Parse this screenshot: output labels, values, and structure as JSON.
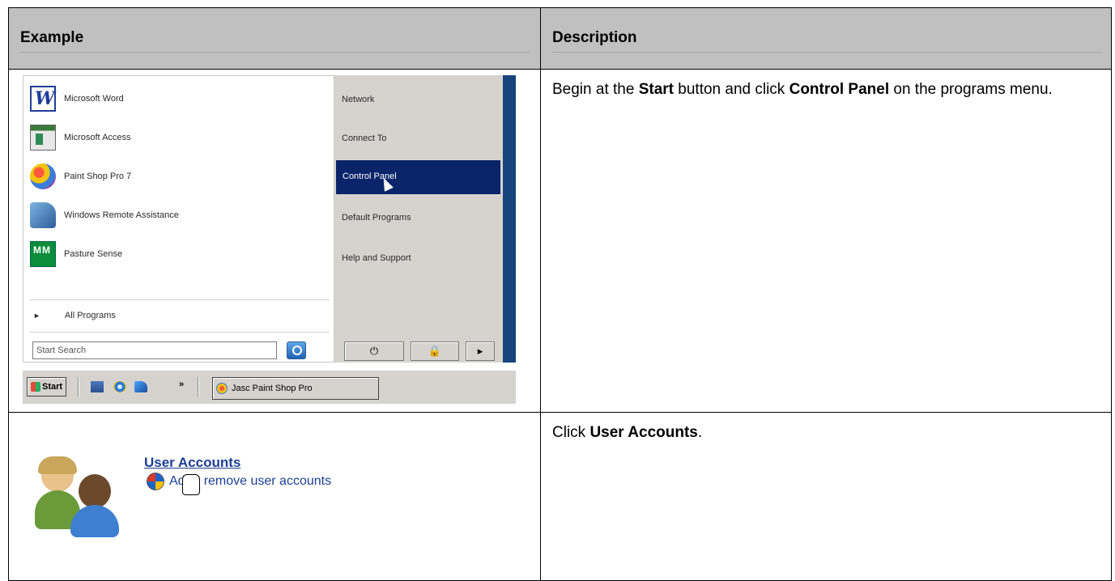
{
  "table": {
    "header_example": "Example",
    "header_description": "Description"
  },
  "rows": [
    {
      "description": [
        {
          "text": "Begin at the ",
          "bold": false
        },
        {
          "text": "Start",
          "bold": true
        },
        {
          "text": " button and click ",
          "bold": false
        },
        {
          "text": "Control Panel",
          "bold": true
        },
        {
          "text": " on the programs menu.",
          "bold": false
        }
      ]
    },
    {
      "description": [
        {
          "text": "Click ",
          "bold": false
        },
        {
          "text": "User Accounts",
          "bold": true
        },
        {
          "text": ".",
          "bold": false
        }
      ]
    }
  ],
  "start_menu": {
    "programs": [
      {
        "label": "Microsoft Word",
        "icon": "word-icon"
      },
      {
        "label": "Microsoft Access",
        "icon": "access-icon"
      },
      {
        "label": "Paint Shop Pro 7",
        "icon": "paint-shop-pro-icon"
      },
      {
        "label": "Windows Remote Assistance",
        "icon": "remote-assistance-icon"
      },
      {
        "label": "Pasture Sense",
        "icon": "pasture-sense-icon"
      }
    ],
    "all_programs": "All Programs",
    "search_placeholder": "Start Search",
    "right_items": [
      "Network",
      "Connect To",
      "Control Panel",
      "Default Programs",
      "Help and Support"
    ],
    "highlighted_item": "Control Panel",
    "power_glyph": "⏻",
    "lock_glyph": "🔒",
    "arrow_glyph": "▸"
  },
  "taskbar": {
    "start_label": "Start",
    "chevron": "»",
    "task_label": "Jasc Paint Shop Pro"
  },
  "user_accounts": {
    "title": "User Accounts",
    "subtitle": "Add or remove user accounts",
    "subtitle_visible": "Ad  or remove user accounts"
  },
  "colors": {
    "header_bg": "#c0c0c0",
    "menu_highlight": "#0a246a",
    "link": "#1c3f94"
  }
}
